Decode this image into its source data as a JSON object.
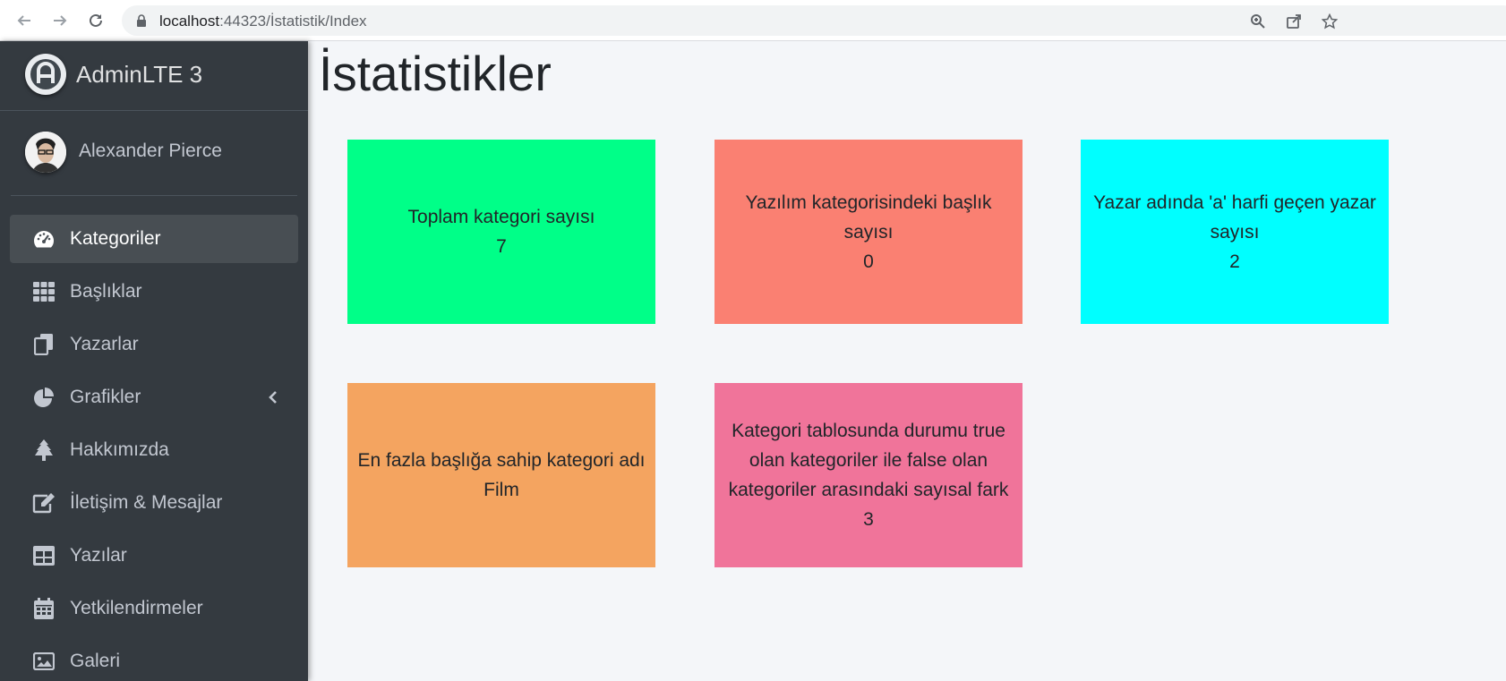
{
  "browser": {
    "url_host": "localhost",
    "url_rest": ":44323/İstatistik/Index"
  },
  "sidebar": {
    "brand": "AdminLTE 3",
    "user_name": "Alexander Pierce",
    "items": [
      {
        "label": "Kategoriler",
        "icon": "tachometer-icon",
        "active": true
      },
      {
        "label": "Başlıklar",
        "icon": "th-grid-icon"
      },
      {
        "label": "Yazarlar",
        "icon": "copy-icon"
      },
      {
        "label": "Grafikler",
        "icon": "pie-chart-icon"
      },
      {
        "label": "Hakkımızda",
        "icon": "tree-icon"
      },
      {
        "label": "İletişim & Mesajlar",
        "icon": "edit-icon"
      },
      {
        "label": "Yazılar",
        "icon": "table-icon"
      },
      {
        "label": "Yetkilendirmeler",
        "icon": "calendar-icon"
      },
      {
        "label": "Galeri",
        "icon": "image-icon"
      }
    ]
  },
  "main": {
    "title": "İstatistikler",
    "cards": [
      {
        "lines": [
          "Toplam kategori sayısı",
          "7"
        ],
        "color": "#00ff88"
      },
      {
        "lines": [
          "Yazılım kategorisindeki başlık sayısı",
          "0"
        ],
        "color": "#fa8072"
      },
      {
        "lines": [
          "Yazar adında 'a' harfi geçen yazar",
          "sayısı",
          "2"
        ],
        "color": "#00ffff"
      },
      {
        "lines": [
          "En fazla başlığa sahip kategori adı",
          "Film"
        ],
        "color": "#f4a460"
      },
      {
        "lines": [
          "Kategori tablosunda durumu true",
          "olan kategoriler ile false olan",
          "kategoriler arasındaki sayısal fark",
          "3"
        ],
        "color": "#f0749a"
      }
    ]
  }
}
